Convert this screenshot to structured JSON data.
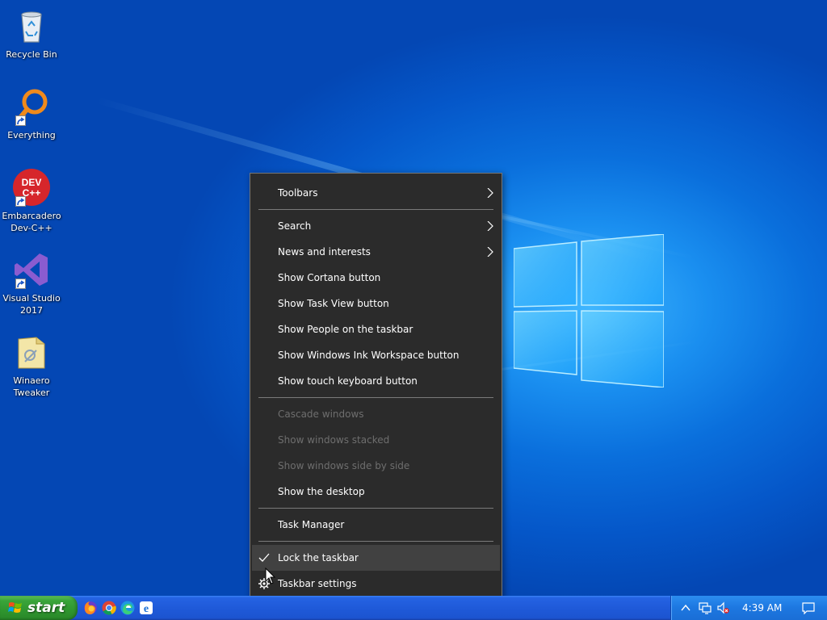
{
  "desktop": {
    "icons": [
      {
        "label": "Recycle Bin",
        "icon": "recycle-bin-icon"
      },
      {
        "label": "Everything",
        "icon": "everything-search-icon"
      },
      {
        "label": "Embarcadero\nDev-C++",
        "icon": "dev-cpp-icon"
      },
      {
        "label": "Visual Studio\n2017",
        "icon": "visual-studio-icon"
      },
      {
        "label": "Winaero\nTweaker",
        "icon": "winaero-tweaker-icon"
      }
    ]
  },
  "context_menu": {
    "items": [
      {
        "label": "Toolbars",
        "submenu": true
      },
      {
        "label": "Search",
        "submenu": true
      },
      {
        "label": "News and interests",
        "submenu": true
      },
      {
        "label": "Show Cortana button"
      },
      {
        "label": "Show Task View button"
      },
      {
        "label": "Show People on the taskbar"
      },
      {
        "label": "Show Windows Ink Workspace button"
      },
      {
        "label": "Show touch keyboard button"
      },
      {
        "label": "Cascade windows",
        "disabled": true
      },
      {
        "label": "Show windows stacked",
        "disabled": true
      },
      {
        "label": "Show windows side by side",
        "disabled": true
      },
      {
        "label": "Show the desktop"
      },
      {
        "label": "Task Manager"
      },
      {
        "label": "Lock the taskbar",
        "checked": true,
        "highlighted": true
      },
      {
        "label": "Taskbar settings",
        "icon": "gear-icon"
      }
    ]
  },
  "taskbar": {
    "start_label": "start",
    "quick_launch": [
      "firefox-icon",
      "chrome-icon",
      "edge-icon",
      "ie-icon"
    ],
    "tray": {
      "icons": [
        "chevron-up-icon",
        "network-icon",
        "volume-muted-icon",
        "action-center-icon"
      ],
      "time": "4:39 AM"
    }
  },
  "colors": {
    "menu_bg": "#2b2b2b",
    "menu_hover": "#414141",
    "menu_disabled_text": "#6e6e6e",
    "taskbar_blue": "#1f5ad9",
    "start_green": "#3aa53a"
  }
}
